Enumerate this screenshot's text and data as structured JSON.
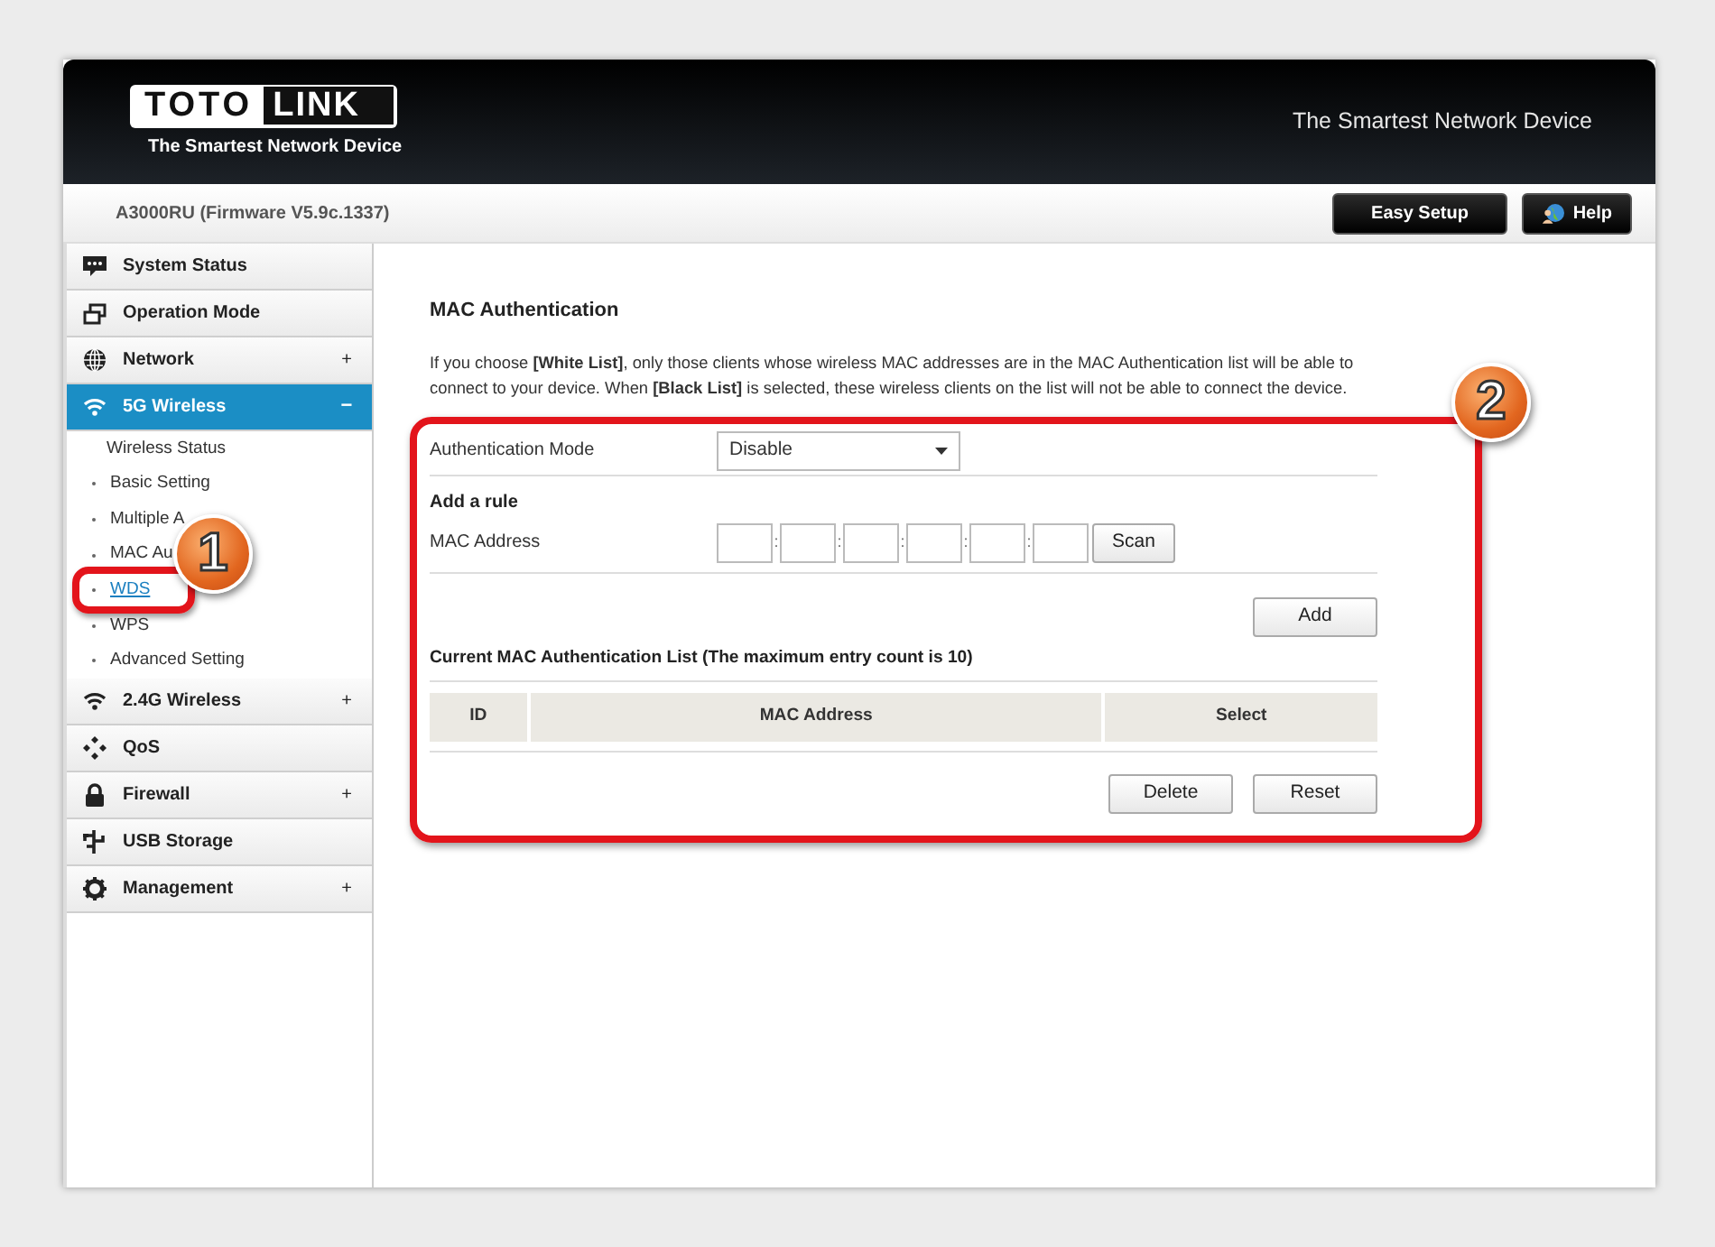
{
  "header": {
    "logo_left": "TOTO",
    "logo_right": "LINK",
    "logo_tagline": "The Smartest Network Device",
    "tagline": "The Smartest Network Device"
  },
  "model_bar": {
    "model": "A3000RU (Firmware V5.9c.1337)",
    "buttons": [
      {
        "label": "Easy Setup",
        "kind": "plain"
      },
      {
        "label": "Help",
        "kind": "help"
      }
    ]
  },
  "sidebar": {
    "items": [
      {
        "label": "System Status",
        "selected": false
      },
      {
        "label": "Operation Mode",
        "selected": false
      },
      {
        "label": "Network",
        "selected": false,
        "toggle": "+"
      },
      {
        "label": "5G Wireless",
        "selected": true,
        "toggle": "−",
        "expanded": true,
        "children": [
          {
            "label": "Wireless Status",
            "kind": "plain",
            "selected": false
          },
          {
            "label": "Basic Setting",
            "kind": "bullet",
            "selected": false
          },
          {
            "label": "Multiple A",
            "kind": "bullet",
            "selected": false
          },
          {
            "label": "MAC Au",
            "kind": "bullet",
            "selected": false
          },
          {
            "label": "WDS",
            "kind": "bullet",
            "selected": true
          },
          {
            "label": "WPS",
            "kind": "bullet",
            "selected": false
          },
          {
            "label": "Advanced Setting",
            "kind": "bullet",
            "selected": false
          }
        ]
      },
      {
        "label": "2.4G Wireless",
        "selected": false,
        "toggle": "+"
      },
      {
        "label": "QoS",
        "selected": false
      },
      {
        "label": "Firewall",
        "selected": false,
        "toggle": "+"
      },
      {
        "label": "USB Storage",
        "selected": false
      },
      {
        "label": "Management",
        "selected": false,
        "toggle": "+"
      }
    ]
  },
  "page": {
    "title": "MAC Authentication",
    "intro": "If you choose **[White List]**, only those clients whose wireless MAC addresses are in the MAC Authentication list will be able to connect to your device. When **[Black List]** is selected, these wireless clients on the list will not be able to connect the device."
  },
  "form": {
    "mode_label": "Authentication Mode",
    "mode_value": "Disable",
    "rule_heading": "Add a rule",
    "mac_label": "MAC Address",
    "mac_separators": [
      ":",
      ":",
      ":",
      ":",
      ":"
    ],
    "scan_button": "Scan",
    "add_button": "Add",
    "list_title": "Current MAC Authentication List (The maximum entry count is 10)",
    "table": {
      "columns": [
        "ID",
        "MAC Address",
        "Select"
      ]
    },
    "buttons": [
      "Delete",
      "Reset"
    ]
  },
  "annotations": {
    "callouts": [
      {
        "label": "1"
      },
      {
        "label": "2"
      }
    ]
  }
}
